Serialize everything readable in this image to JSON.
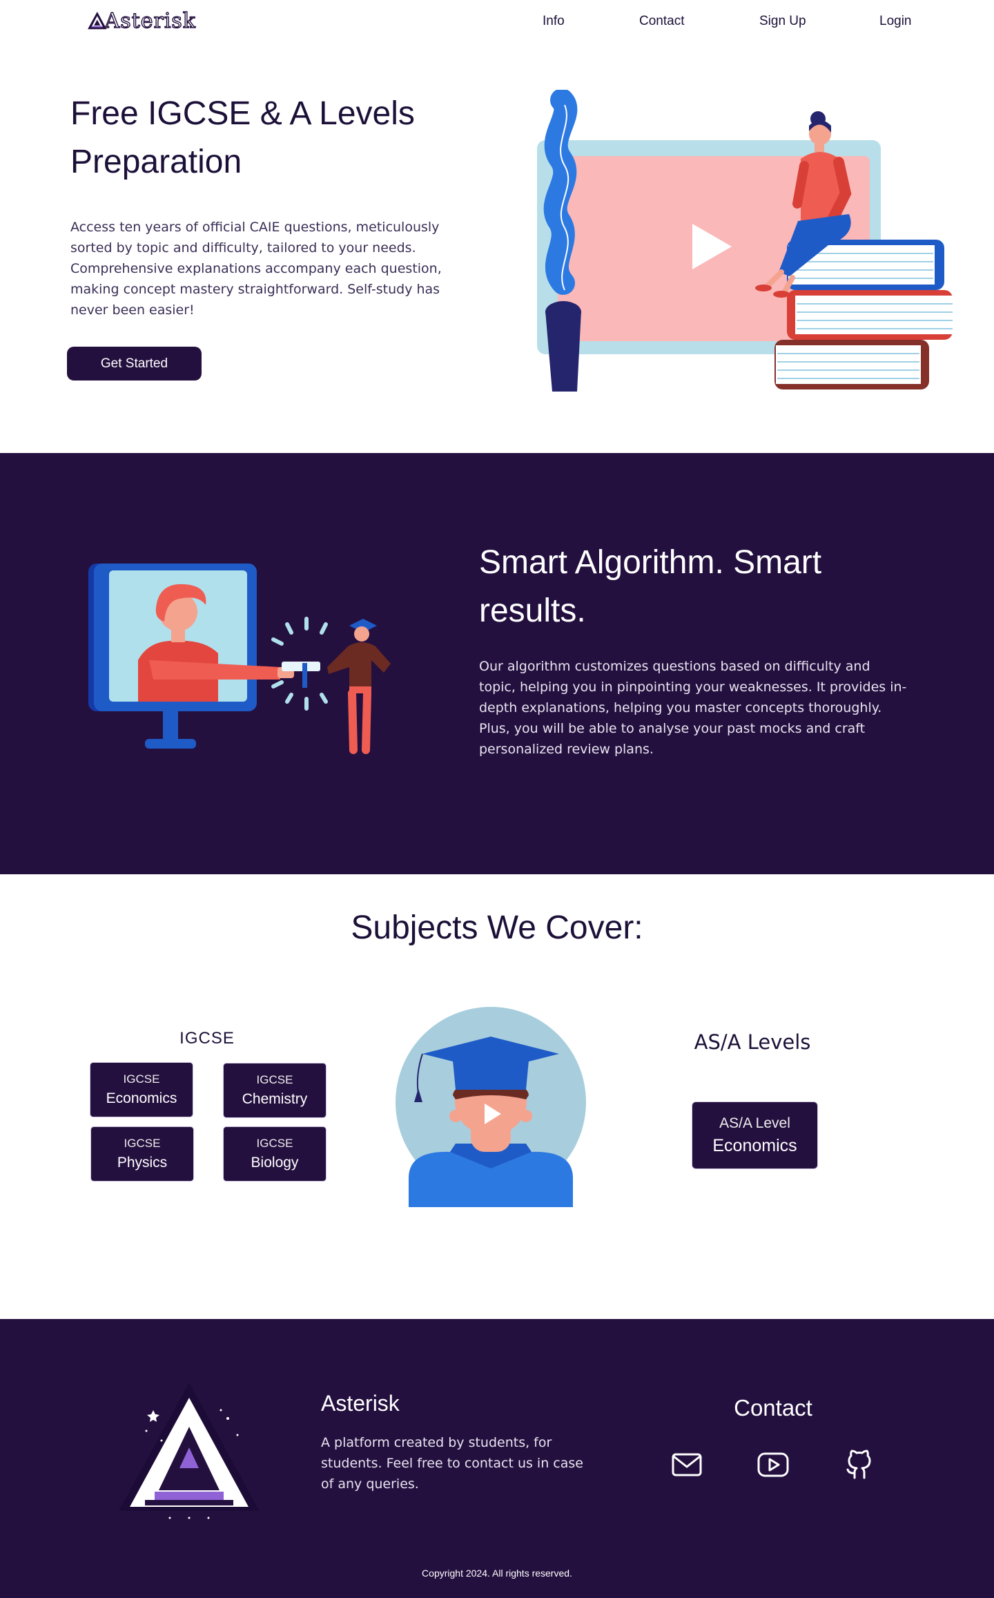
{
  "nav": {
    "brand": "Asterisk",
    "links": [
      {
        "label": "Info"
      },
      {
        "label": "Contact"
      },
      {
        "label": "Sign Up"
      },
      {
        "label": "Login"
      }
    ]
  },
  "hero": {
    "title": "Free IGCSE & A Levels Preparation",
    "description": "Access ten years of official CAIE questions, meticulously sorted by topic and difficulty, tailored to your needs. Comprehensive explanations accompany each question, making concept mastery straightforward. Self-study has never been easier!",
    "cta": "Get Started"
  },
  "algorithm": {
    "title": "Smart Algorithm. Smart results.",
    "description": "Our algorithm customizes questions based on difficulty and topic, helping you in pinpointing your weaknesses. It provides in-depth explanations, helping you master concepts thoroughly. Plus, you will be able to analyse your past mocks and craft personalized review plans."
  },
  "subjects": {
    "title": "Subjects We Cover:",
    "igcse_heading": "IGCSE",
    "alevel_heading": "AS/A Levels",
    "igcse": [
      {
        "level": "IGCSE",
        "name": "Economics"
      },
      {
        "level": "IGCSE",
        "name": "Chemistry"
      },
      {
        "level": "IGCSE",
        "name": "Physics"
      },
      {
        "level": "IGCSE",
        "name": "Biology"
      }
    ],
    "alevel": [
      {
        "level": "AS/A Level",
        "name": "Economics"
      }
    ]
  },
  "footer": {
    "name": "Asterisk",
    "description": "A platform created by students, for students. Feel free to contact us in case of any queries.",
    "contact_heading": "Contact",
    "icons": [
      "mail-icon",
      "youtube-icon",
      "github-icon"
    ],
    "copyright": "Copyright 2024. All rights reserved."
  },
  "colors": {
    "primary": "#24103f",
    "text": "#1c1038",
    "white": "#ffffff"
  }
}
